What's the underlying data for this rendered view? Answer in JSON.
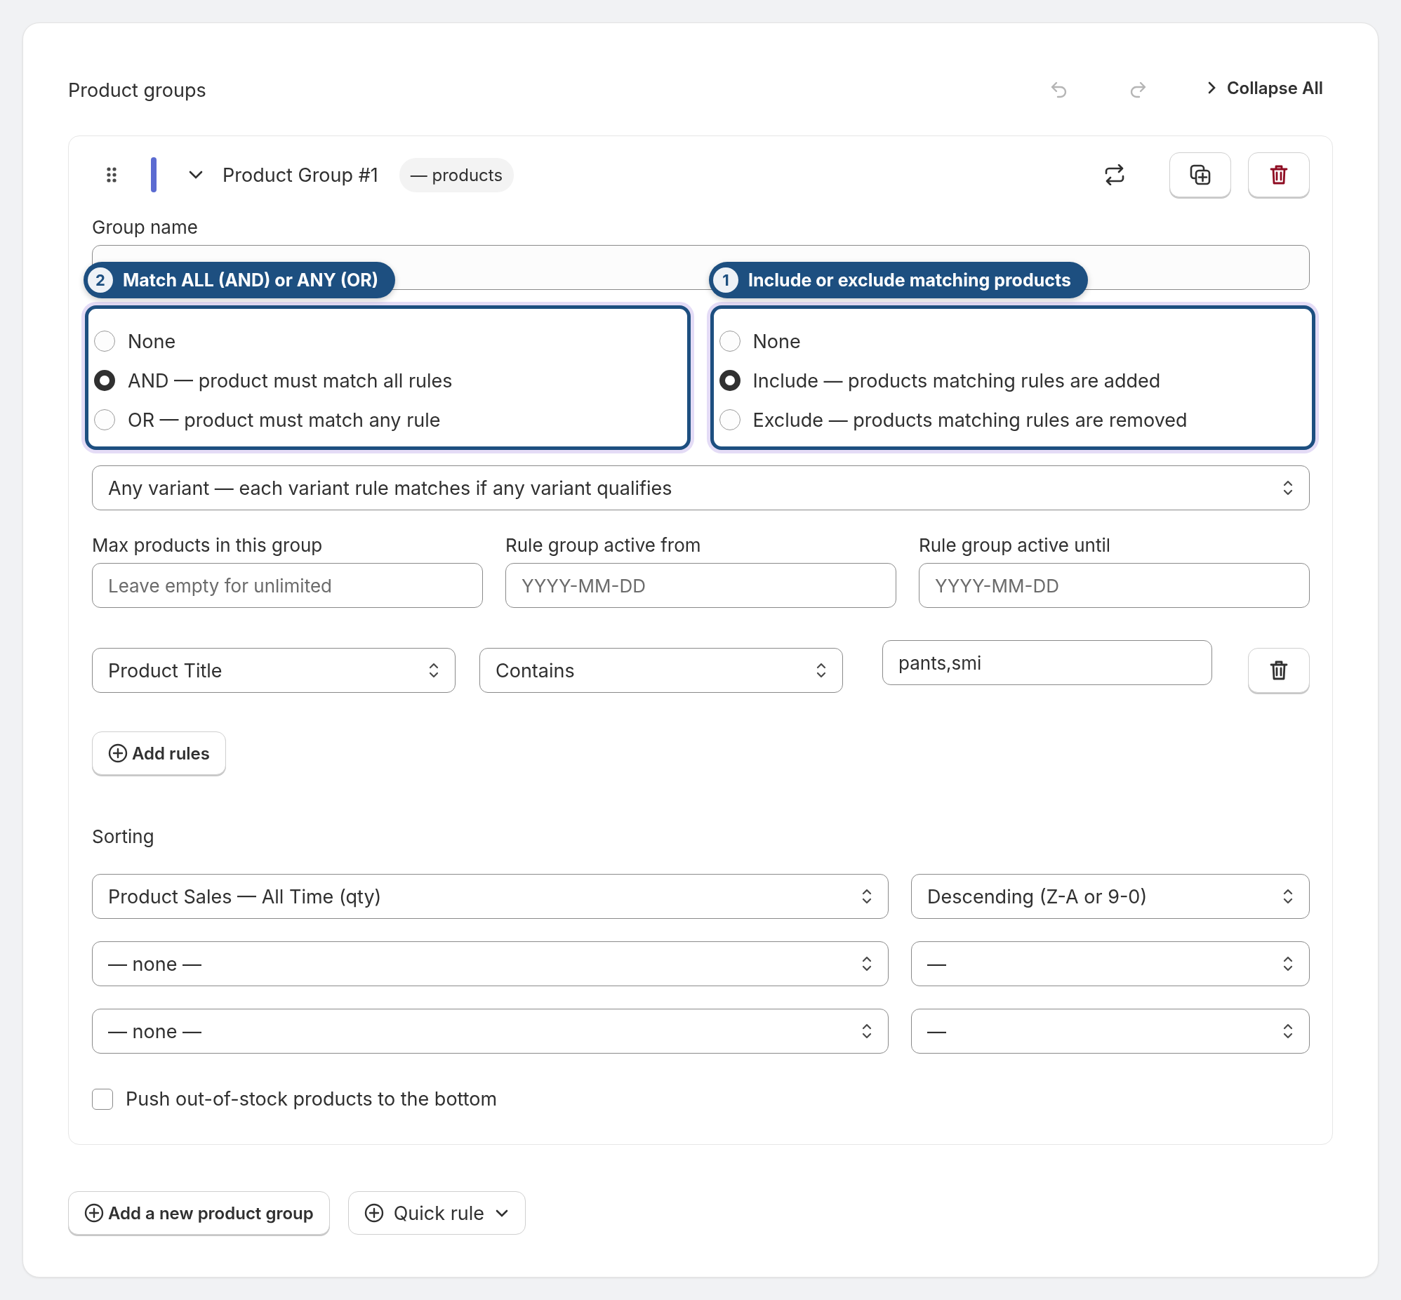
{
  "header": {
    "title": "Product groups",
    "undo": {
      "disabled": true
    },
    "redo": {
      "disabled": true
    },
    "collapse_label": "Collapse All"
  },
  "group": {
    "title": "Product Group #1",
    "count_badge": "— products",
    "name_label": "Group name",
    "hints": [
      {
        "number": "2",
        "text": "Match ALL (AND) or ANY (OR)"
      },
      {
        "number": "1",
        "text": "Include or exclude matching products"
      }
    ],
    "match_options": [
      {
        "label": "None",
        "selected": false
      },
      {
        "label": "AND — product must match all rules",
        "selected": true
      },
      {
        "label": "OR — product must match any rule",
        "selected": false
      }
    ],
    "mode_options": [
      {
        "label": "None",
        "selected": false
      },
      {
        "label": "Include — products matching rules are added",
        "selected": true
      },
      {
        "label": "Exclude — products matching rules are removed",
        "selected": false
      }
    ],
    "variant_select": "Any variant — each variant rule matches if any variant qualifies",
    "fields": [
      {
        "label": "Max products in this group",
        "placeholder": "Leave empty for unlimited"
      },
      {
        "label": "Rule group active from",
        "placeholder": "YYYY-MM-DD"
      },
      {
        "label": "Rule group active until",
        "placeholder": "YYYY-MM-DD"
      }
    ],
    "rule": {
      "attribute": "Product Title",
      "operator": "Contains",
      "value": "pants,smi"
    },
    "add_rules": "Add rules",
    "sorting": {
      "label": "Sorting",
      "rows": [
        {
          "field": "Product Sales — All Time (qty)",
          "order": "Descending (Z-A or 9-0)"
        },
        {
          "field": "— none —",
          "order": "—"
        },
        {
          "field": "— none —",
          "order": "—"
        }
      ]
    },
    "push_out_of_stock": {
      "label": "Push out-of-stock products to the bottom",
      "checked": false
    }
  },
  "footer": {
    "add_group": "Add a new product group",
    "quick_rule": "Quick rule"
  }
}
